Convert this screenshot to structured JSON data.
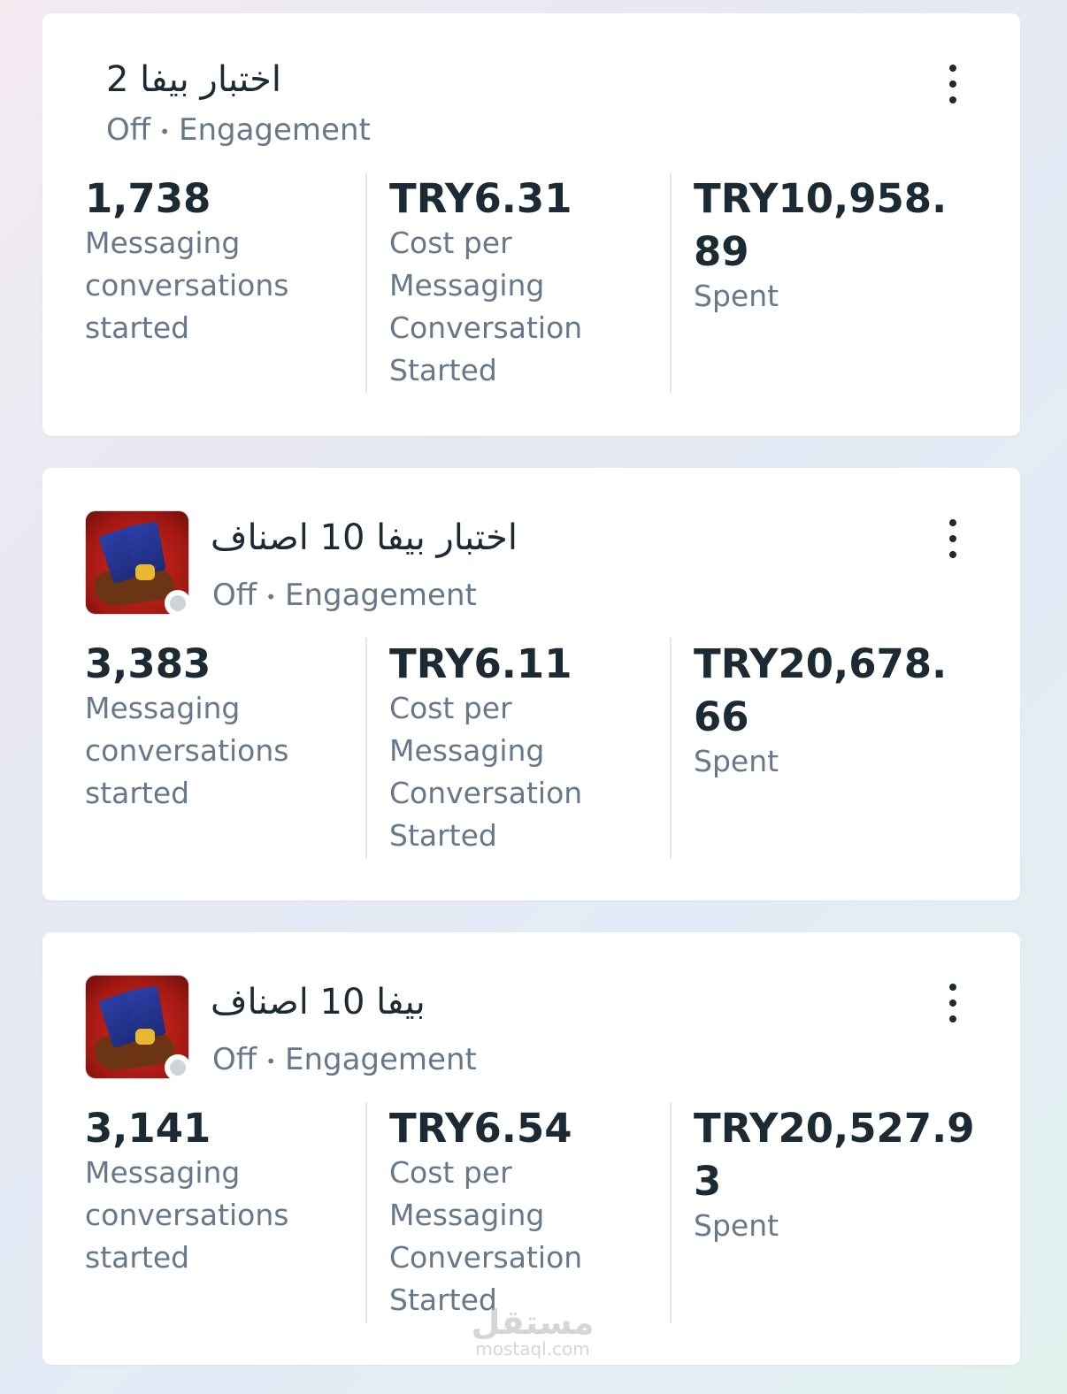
{
  "campaigns": [
    {
      "name": "اختبار بيفا 2",
      "status": "Off",
      "separator": "•",
      "objective": "Engagement",
      "has_thumbnail": false,
      "metrics": [
        {
          "value": "1,738",
          "label": "Messaging conversations started"
        },
        {
          "value": "TRY6.31",
          "label": "Cost per Messaging Conversation Started"
        },
        {
          "value": "TRY10,958.89",
          "label": "Spent"
        }
      ]
    },
    {
      "name": "اختبار بيفا 10 اصناف",
      "status": "Off",
      "separator": "•",
      "objective": "Engagement",
      "has_thumbnail": true,
      "metrics": [
        {
          "value": "3,383",
          "label": "Messaging conversations started"
        },
        {
          "value": "TRY6.11",
          "label": "Cost per Messaging Conversation Started"
        },
        {
          "value": "TRY20,678.66",
          "label": "Spent"
        }
      ]
    },
    {
      "name": "بيفا 10 اصناف",
      "status": "Off",
      "separator": "•",
      "objective": "Engagement",
      "has_thumbnail": true,
      "metrics": [
        {
          "value": "3,141",
          "label": "Messaging conversations started"
        },
        {
          "value": "TRY6.54",
          "label": "Cost per Messaging Conversation Started"
        },
        {
          "value": "TRY20,527.93",
          "label": "Spent"
        }
      ]
    }
  ],
  "watermark": {
    "arabic": "مستقل",
    "latin": "mostaql.com"
  },
  "colors": {
    "text_primary": "#1c2b33",
    "text_secondary": "#67788a",
    "status_off_dot": "#cfd4db",
    "divider": "#e3e6ea"
  },
  "icons": {
    "menu": "more-vertical-icon",
    "status": "status-dot-icon"
  }
}
